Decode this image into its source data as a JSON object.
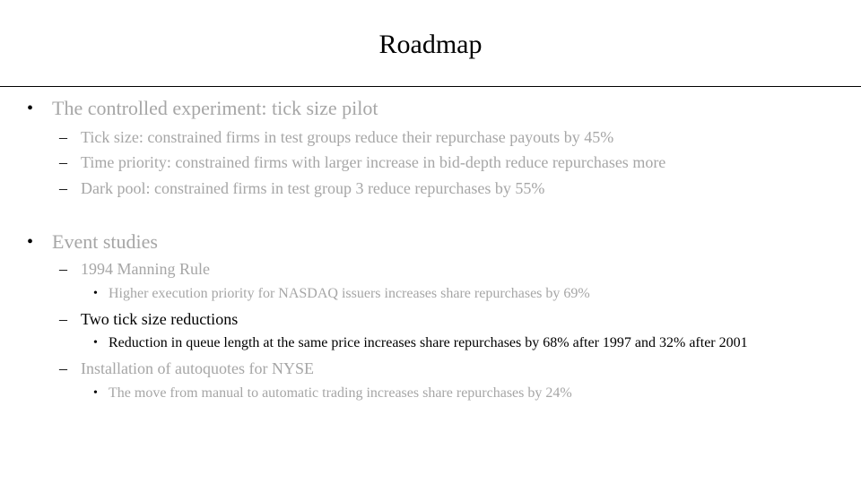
{
  "slide": {
    "title": "Roadmap",
    "colors": {
      "dim_text": "#a6a6a6",
      "active_text": "#000000",
      "markers": "#000000"
    },
    "sections": [
      {
        "label": "The controlled experiment: tick size pilot",
        "items": [
          {
            "label": "Tick size: constrained firms in test groups reduce their repurchase payouts by 45%"
          },
          {
            "label": "Time priority: constrained firms with larger increase in bid-depth reduce repurchases more"
          },
          {
            "label": "Dark pool: constrained firms in test group 3 reduce repurchases by 55%"
          }
        ]
      },
      {
        "label": "Event studies",
        "items": [
          {
            "label": "1994 Manning Rule",
            "detail": "Higher execution priority for NASDAQ issuers increases share repurchases by 69%"
          },
          {
            "label": "Two tick size reductions",
            "detail": "Reduction in queue length at the same price increases share repurchases by 68% after 1997 and 32% after 2001",
            "highlighted": true
          },
          {
            "label": "Installation of autoquotes for NYSE",
            "detail": "The move from manual to automatic trading increases share repurchases by 24%"
          }
        ]
      }
    ],
    "markers": {
      "level1": "•",
      "level2": "–",
      "level3": "•"
    }
  }
}
